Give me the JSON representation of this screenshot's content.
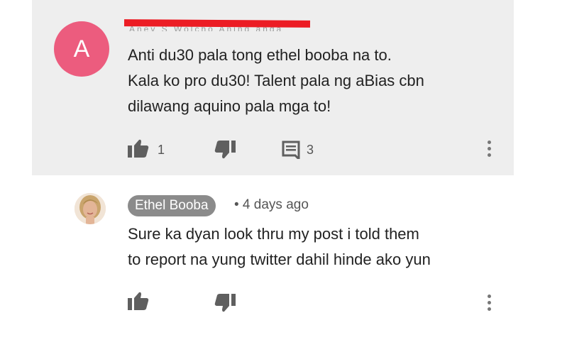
{
  "comment": {
    "avatar_letter": "A",
    "author_redacted": "Aney S Wolcho Aning anga",
    "lines": [
      "Anti du30 pala tong ethel booba na to.",
      "Kala ko pro du30! Talent pala ng aBias cbn",
      "dilawang aquino pala mga to!"
    ],
    "like_count": "1",
    "reply_count": "3",
    "icons": {
      "like": "thumbs-up-icon",
      "dislike": "thumbs-down-icon",
      "reply": "comment-icon",
      "menu": "more-vert-icon"
    }
  },
  "reply": {
    "author": "Ethel Booba",
    "meta": "• 4 days ago",
    "lines": [
      "Sure ka dyan look thru my post i told them",
      "to report na yung twitter dahil hinde ako yun"
    ]
  },
  "colors": {
    "avatar_bg": "#ec5c7e",
    "highlight_bg": "#eeeeee",
    "redaction": "#ec1c24",
    "chip_bg": "#8b8b8b",
    "icon": "#5f5f5f"
  }
}
